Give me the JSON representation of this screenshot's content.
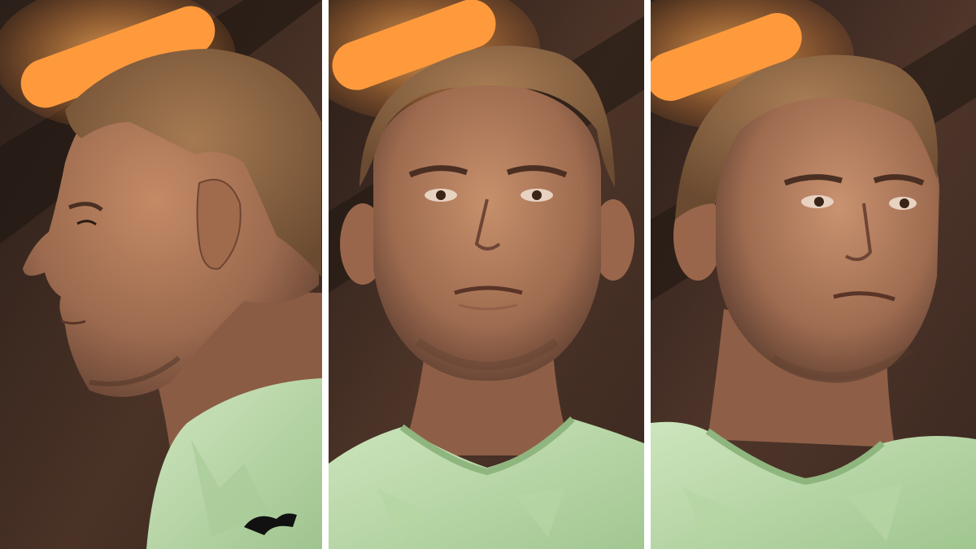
{
  "image": {
    "kind": "photo-collage",
    "panel_count": 3,
    "panels": [
      {
        "view": "left-profile"
      },
      {
        "view": "front"
      },
      {
        "view": "three-quarter-right"
      }
    ],
    "colors": {
      "background": "#3a2a22",
      "light_strip": "#ff9a3c",
      "skin": "#b07a5a",
      "hair": "#8a6440",
      "jersey": "#bcd9ad",
      "divider": "#ffffff"
    }
  }
}
